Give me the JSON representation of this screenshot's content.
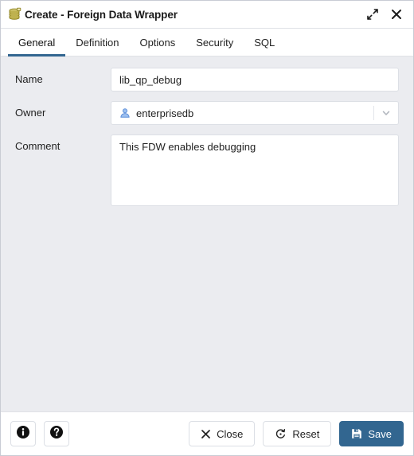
{
  "window": {
    "title": "Create - Foreign Data Wrapper",
    "icon": "foreign-data-wrapper-icon",
    "expand_icon": "expand-diagonal-icon",
    "close_icon": "close-icon"
  },
  "tabs": [
    {
      "label": "General",
      "active": true
    },
    {
      "label": "Definition",
      "active": false
    },
    {
      "label": "Options",
      "active": false
    },
    {
      "label": "Security",
      "active": false
    },
    {
      "label": "SQL",
      "active": false
    }
  ],
  "fields": {
    "name": {
      "label": "Name",
      "value": "lib_qp_debug",
      "placeholder": ""
    },
    "owner": {
      "label": "Owner",
      "value": "enterprisedb",
      "icon": "user-icon",
      "dropdown_icon": "chevron-down-icon"
    },
    "comment": {
      "label": "Comment",
      "value": "This FDW enables debugging",
      "placeholder": ""
    }
  },
  "footer": {
    "info_icon": "info-circle-icon",
    "help_icon": "question-circle-icon",
    "close_label": "Close",
    "close_icon": "x-icon",
    "reset_label": "Reset",
    "reset_icon": "reset-circular-arrow-icon",
    "save_label": "Save",
    "save_icon": "floppy-disk-save-icon"
  },
  "colors": {
    "accent": "#326690",
    "body_bg": "#ebecf0",
    "panel_bg": "#ffffff",
    "border": "#dcdfe5",
    "text": "#222222",
    "icon_olive": "#a89c3a",
    "user_icon_blue": "#5b8dd9"
  }
}
